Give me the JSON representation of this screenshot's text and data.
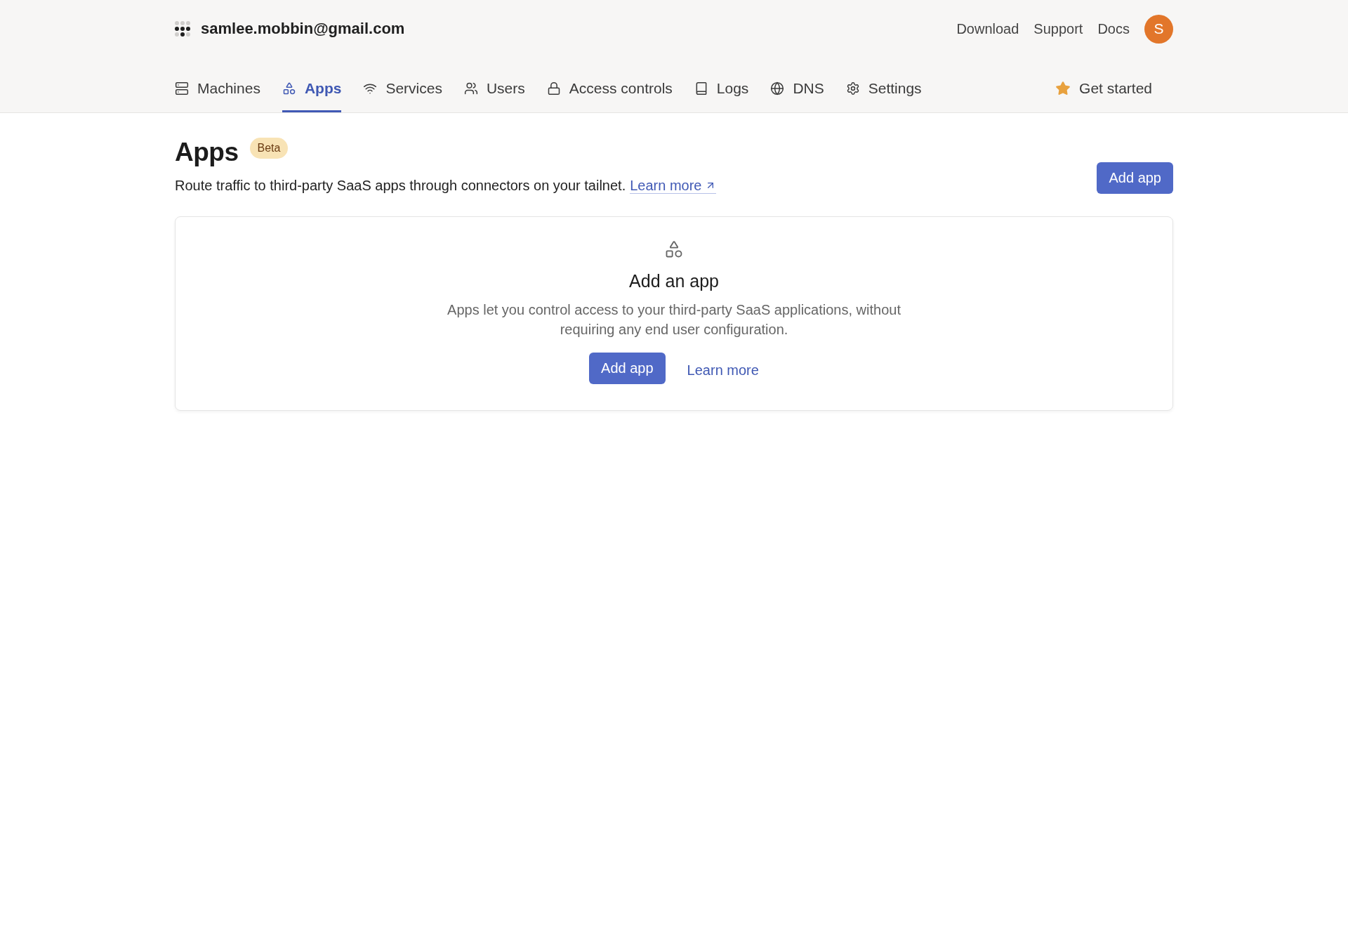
{
  "header": {
    "account": "samlee.mobbin@gmail.com",
    "links": [
      "Download",
      "Support",
      "Docs"
    ],
    "avatar": "S"
  },
  "nav": {
    "tabs": [
      {
        "label": "Machines",
        "selected": false
      },
      {
        "label": "Apps",
        "selected": true
      },
      {
        "label": "Services",
        "selected": false
      },
      {
        "label": "Users",
        "selected": false
      },
      {
        "label": "Access controls",
        "selected": false
      },
      {
        "label": "Logs",
        "selected": false
      },
      {
        "label": "DNS",
        "selected": false
      },
      {
        "label": "Settings",
        "selected": false
      }
    ],
    "get_started": "Get started"
  },
  "page": {
    "title": "Apps",
    "badge": "Beta",
    "description": "Route traffic to third-party SaaS apps through connectors on your tailnet.",
    "learn_more": "Learn more",
    "add_button": "Add app"
  },
  "empty_state": {
    "title": "Add an app",
    "description": "Apps let you control access to your third-party SaaS applications, without requiring any end user configuration.",
    "primary_button": "Add app",
    "link": "Learn more"
  }
}
